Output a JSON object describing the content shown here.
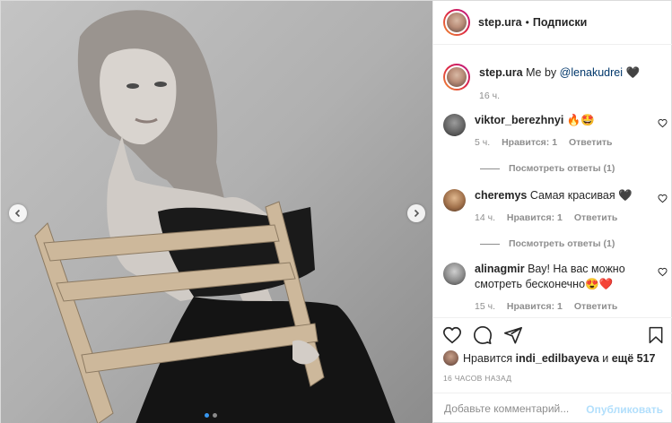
{
  "header": {
    "username": "step.ura",
    "separator": "•",
    "follow_label": "Подписки"
  },
  "caption": {
    "username": "step.ura",
    "text": "Me by",
    "mention": "@lenakudrei",
    "emoji": "🖤",
    "time": "16 ч."
  },
  "comments": [
    {
      "username": "viktor_berezhnyi",
      "text": "🔥🤩",
      "time": "5 ч.",
      "likes": "Нравится: 1",
      "reply": "Ответить",
      "view_replies": "Посмотреть ответы (1)"
    },
    {
      "username": "cheremys",
      "text": "Самая красивая 🖤",
      "time": "14 ч.",
      "likes": "Нравится: 1",
      "reply": "Ответить",
      "view_replies": "Посмотреть ответы (1)"
    },
    {
      "username": "alinagmir",
      "text": "Вау! На вас можно смотреть бесконечно😍❤️",
      "time": "15 ч.",
      "likes": "Нравится: 1",
      "reply": "Ответить"
    }
  ],
  "likes": {
    "prefix": "Нравится",
    "user": "indi_edilbayeva",
    "and": "и",
    "others": "ещё 517"
  },
  "timestamp": "16 ЧАСОВ НАЗАД",
  "comment_box": {
    "placeholder": "Добавьте комментарий...",
    "publish_label": "Опубликовать"
  },
  "carousel": {
    "total": 2,
    "active_index": 0
  },
  "colors": {
    "accent": "#3897f0",
    "link": "#00376b",
    "muted": "#8e8e8e",
    "publish_disabled": "#b2dffc"
  },
  "icons": {
    "like": "heart-icon",
    "comment": "comment-icon",
    "share": "share-icon",
    "save": "bookmark-icon",
    "prev": "chevron-left-icon",
    "next": "chevron-right-icon"
  }
}
